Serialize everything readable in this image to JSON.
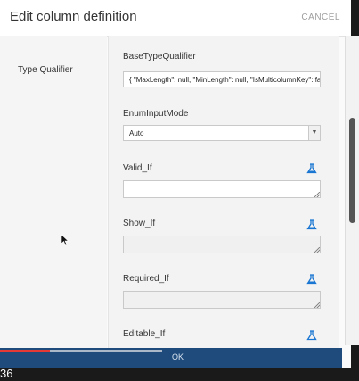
{
  "dialog": {
    "title": "Edit column definition",
    "cancel_label": "CANCEL",
    "ok_label": "OK"
  },
  "left": {
    "type_qualifier_label": "Type Qualifier"
  },
  "fields": {
    "base_type_qualifier": {
      "label": "BaseTypeQualifier",
      "value": "{  \"MaxLength\": null,  \"MinLength\": null,  \"IsMulticolumnKey\": false"
    },
    "enum_input_mode": {
      "label": "EnumInputMode",
      "selected": "Auto"
    },
    "valid_if": {
      "label": "Valid_If",
      "icon": "flask-icon"
    },
    "show_if": {
      "label": "Show_If",
      "icon": "flask-icon"
    },
    "required_if": {
      "label": "Required_If",
      "icon": "flask-icon"
    },
    "editable_if": {
      "label": "Editable_If",
      "icon": "flask-icon"
    }
  },
  "video": {
    "timestamp": "36",
    "progress_fraction": 0.14
  },
  "colors": {
    "ok_bar": "#1e4b7c",
    "flask": "#1976d2",
    "progress": "#e53935"
  }
}
